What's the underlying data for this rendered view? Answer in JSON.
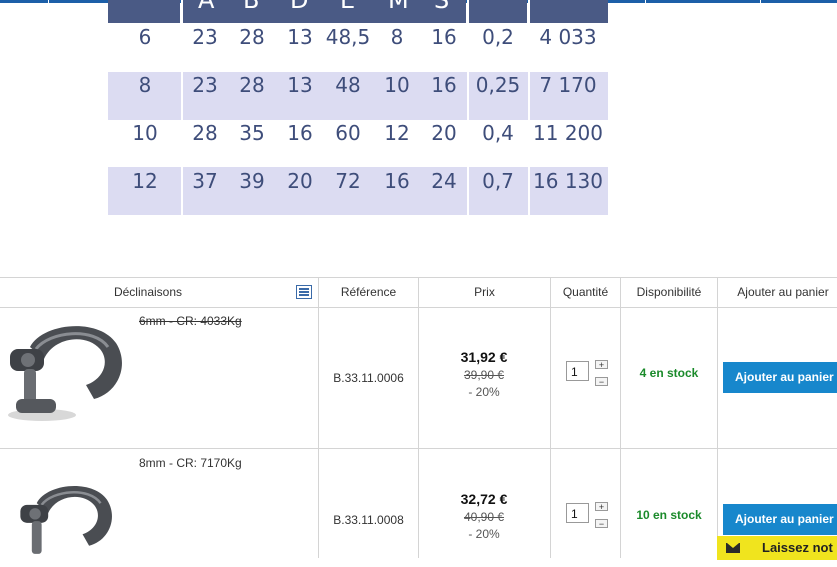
{
  "spec_table": {
    "header_letters": [
      "A",
      "B",
      "D",
      "E",
      "M",
      "S"
    ],
    "rows": [
      [
        "6",
        "23",
        "28",
        "13",
        "48,5",
        "8",
        "16",
        "0,2",
        "4 033"
      ],
      [
        "8",
        "23",
        "28",
        "13",
        "48",
        "10",
        "16",
        "0,25",
        "7 170"
      ],
      [
        "10",
        "28",
        "35",
        "16",
        "60",
        "12",
        "20",
        "0,4",
        "11 200"
      ],
      [
        "12",
        "37",
        "39",
        "20",
        "72",
        "16",
        "24",
        "0,7",
        "16 130"
      ]
    ]
  },
  "table": {
    "headers": {
      "variants": "Déclinaisons",
      "reference": "Référence",
      "price": "Prix",
      "quantity": "Quantité",
      "availability": "Disponibilité",
      "add": "Ajouter au panier"
    },
    "rows": [
      {
        "variant": "6mm - CR: 4033Kg",
        "reference": "B.33.11.0006",
        "price": "31,92 €",
        "old_price": "39,90 €",
        "discount": "- 20%",
        "qty": "1",
        "stock": "4 en stock",
        "button": "Ajouter au panier"
      },
      {
        "variant": "8mm - CR: 7170Kg",
        "reference": "B.33.11.0008",
        "price": "32,72 €",
        "old_price": "40,90 €",
        "discount": "- 20%",
        "qty": "1",
        "stock": "10 en stock",
        "button": "Ajouter au panier"
      }
    ]
  },
  "stepper": {
    "plus": "+",
    "minus": "−"
  },
  "chat": {
    "label": "Laissez not",
    "icon": "envelope-icon"
  },
  "colors": {
    "accent": "#1787cc",
    "stock": "#1a8a2a",
    "chat": "#f0e41e"
  }
}
